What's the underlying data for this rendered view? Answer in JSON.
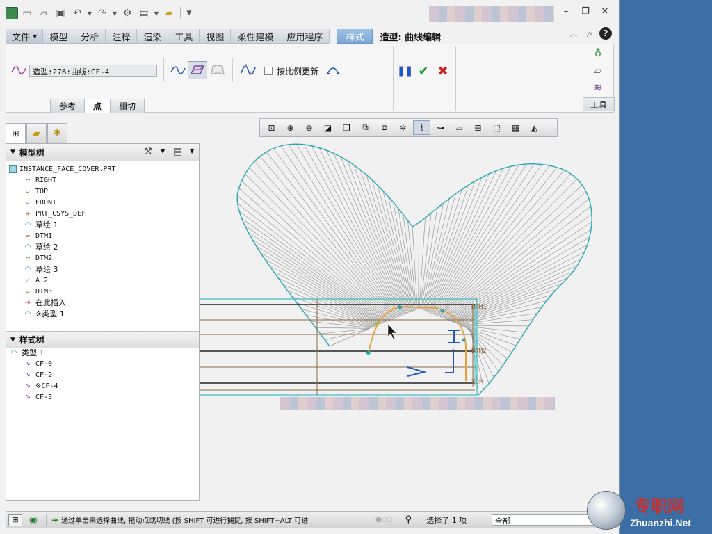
{
  "ribbon_tabs": {
    "file": "文件",
    "items": [
      "模型",
      "分析",
      "注释",
      "渲染",
      "工具",
      "视图",
      "柔性建模",
      "应用程序"
    ],
    "active": "样式",
    "context_label": "造型: 曲线编辑"
  },
  "ribbon": {
    "curve_field_value": "造型:276:曲线:CF-4",
    "proportional_update_label": "按比例更新",
    "tools_label": "工具",
    "subtabs": [
      "参考",
      "点",
      "相切"
    ]
  },
  "model_tree": {
    "header": "模型树",
    "root": "INSTANCE_FACE_COVER.PRT",
    "items": [
      {
        "label": "RIGHT",
        "icon": "datum-plane-icon"
      },
      {
        "label": "TOP",
        "icon": "datum-plane-icon"
      },
      {
        "label": "FRONT",
        "icon": "datum-plane-icon"
      },
      {
        "label": "PRT_CSYS_DEF",
        "icon": "csys-icon"
      },
      {
        "label": "草绘 1",
        "icon": "sketch-icon"
      },
      {
        "label": "DTM1",
        "icon": "datum-plane-icon"
      },
      {
        "label": "草绘 2",
        "icon": "sketch-icon"
      },
      {
        "label": "DTM2",
        "icon": "datum-plane-icon"
      },
      {
        "label": "草绘 3",
        "icon": "sketch-icon"
      },
      {
        "label": "A_2",
        "icon": "datum-axis-icon"
      },
      {
        "label": "DTM3",
        "icon": "datum-plane-icon"
      },
      {
        "label": "在此插入",
        "icon": "insert-arrow-icon"
      },
      {
        "label": "※类型 1",
        "icon": "style-feature-icon"
      }
    ]
  },
  "style_tree": {
    "header": "样式树",
    "root": "类型 1",
    "items": [
      "CF-0",
      "CF-2",
      "※CF-4",
      "CF-3"
    ]
  },
  "viewport": {
    "datum_labels": [
      "DTM1",
      "DTM2",
      "TOP"
    ]
  },
  "statusbar": {
    "message": "通过单击来选择曲线, 拖动点或切线 (按 SHIFT 可进行捕捉, 按 SHIFT+ALT 可进",
    "selected": "选择了 1 项",
    "filter": "全部"
  },
  "watermark": {
    "cn": "专职网",
    "en": "Zhuanzhi.Net"
  },
  "colors": {
    "active_tab": "#7aa6d4",
    "curve_cyan": "#2aa6b6",
    "curve_orange": "#e3a33a",
    "accept_green": "#1f9a2d",
    "cancel_red": "#c8201e",
    "pause_blue": "#2456c9"
  }
}
